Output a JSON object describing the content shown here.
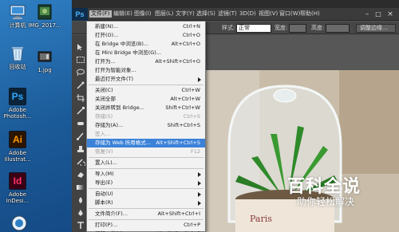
{
  "desktop": {
    "icons": [
      {
        "label": "计算机"
      },
      {
        "label": "IMG_2017..."
      },
      {
        "label": "回收站"
      },
      {
        "label": "1.jpg"
      },
      {
        "label": "Adobe Photosh...",
        "tile_text": "Ps",
        "color": "#31a8ff"
      },
      {
        "label": "Adobe Illustrat...",
        "tile_text": "Ai",
        "color": "#ff9a00"
      },
      {
        "label": "Adobe InDesi...",
        "tile_text": "Id",
        "color": "#ff3366"
      }
    ]
  },
  "app": {
    "logo": "Ps",
    "menus": [
      "文件(F)",
      "编辑(E)",
      "图像(I)",
      "图层(L)",
      "文字(Y)",
      "选择(S)",
      "滤镜(T)",
      "3D(D)",
      "视图(V)",
      "窗口(W)",
      "帮助(H)"
    ],
    "active_menu": "文件(F)"
  },
  "options_bar": {
    "style_label": "样式:",
    "style_value": "正常",
    "width_label": "宽度:",
    "height_label": "高度:",
    "adjust_edge_button": "调整边缘..."
  },
  "file_menu": {
    "items": [
      {
        "label": "新建(N)...",
        "shortcut": "Ctrl+N"
      },
      {
        "label": "打开(O)...",
        "shortcut": "Ctrl+O"
      },
      {
        "label": "在 Bridge 中浏览(B)...",
        "shortcut": "Alt+Ctrl+O"
      },
      {
        "label": "在 Mini Bridge 中浏览(G)...",
        "shortcut": ""
      },
      {
        "label": "打开为...",
        "shortcut": "Alt+Shift+Ctrl+O"
      },
      {
        "label": "打开为智能对象...",
        "shortcut": ""
      },
      {
        "label": "最近打开文件(T)",
        "shortcut": "",
        "submenu": true
      },
      {
        "sep": true
      },
      {
        "label": "关闭(C)",
        "shortcut": "Ctrl+W"
      },
      {
        "label": "关闭全部",
        "shortcut": "Alt+Ctrl+W"
      },
      {
        "label": "关闭并转到 Bridge...",
        "shortcut": "Shift+Ctrl+W"
      },
      {
        "label": "存储(S)",
        "shortcut": "Ctrl+S",
        "disabled": true
      },
      {
        "label": "存储为(A)...",
        "shortcut": "Shift+Ctrl+S"
      },
      {
        "label": "签入...",
        "shortcut": "",
        "disabled": true
      },
      {
        "label": "存储为 Web 所用格式...",
        "shortcut": "Alt+Shift+Ctrl+S",
        "highlight": true
      },
      {
        "label": "恢复(V)",
        "shortcut": "F12",
        "disabled": true
      },
      {
        "sep": true
      },
      {
        "label": "置入(L)...",
        "shortcut": ""
      },
      {
        "sep": true
      },
      {
        "label": "导入(M)",
        "shortcut": "",
        "submenu": true
      },
      {
        "label": "导出(E)",
        "shortcut": "",
        "submenu": true
      },
      {
        "sep": true
      },
      {
        "label": "自动(U)",
        "shortcut": "",
        "submenu": true
      },
      {
        "label": "脚本(R)",
        "shortcut": "",
        "submenu": true
      },
      {
        "sep": true
      },
      {
        "label": "文件简介(F)...",
        "shortcut": "Alt+Shift+Ctrl+I"
      },
      {
        "sep": true
      },
      {
        "label": "打印(P)...",
        "shortcut": "Ctrl+P"
      },
      {
        "label": "打印一份(Y)",
        "shortcut": "Alt+Shift+Ctrl+P"
      }
    ]
  },
  "watermark": {
    "title": "百科全说",
    "subtitle": "助你轻松解决"
  },
  "colors": {
    "menu_highlight": "#3b82d8",
    "ps_blue": "#31a8ff"
  }
}
